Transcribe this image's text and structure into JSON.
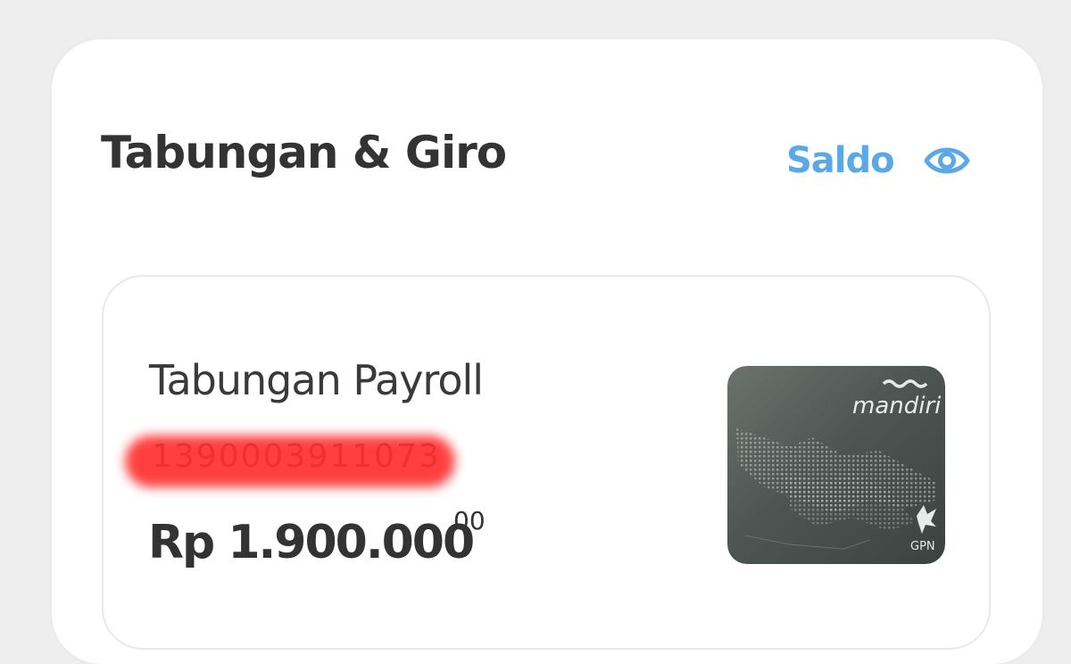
{
  "section": {
    "title": "Tabungan & Giro",
    "balance_toggle_label": "Saldo",
    "balance_toggle_icon": "eye-icon"
  },
  "account": {
    "name": "Tabungan Payroll",
    "number": "1390003911073",
    "number_redacted": true,
    "balance": "Rp 1.900.000",
    "balance_cents": "00",
    "card_brand": "mandiri",
    "card_network": "GPN"
  },
  "colors": {
    "background": "#eeeeee",
    "panel": "#ffffff",
    "title_text": "#333333",
    "accent": "#5aa8e6",
    "redaction": "#ff2f2f",
    "card_base": "#4d5552"
  }
}
